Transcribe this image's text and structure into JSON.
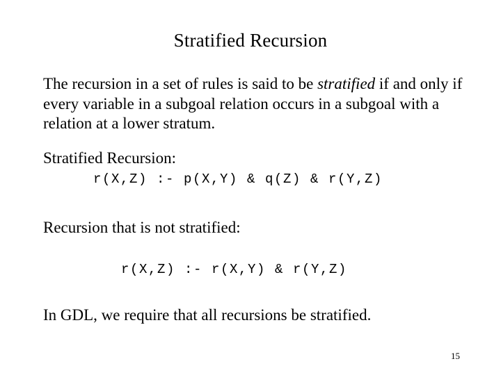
{
  "slide": {
    "title": "Stratified Recursion",
    "background_color": "#ffffff",
    "text_color": "#000000",
    "page_number": "15"
  },
  "definition": {
    "text_before_emphasis": "The recursion in a set of rules is said to be ",
    "emphasized_term": "stratified",
    "text_after_emphasis": " if and only if every variable in a subgoal relation occurs in a subgoal with a relation at a lower stratum."
  },
  "examples": {
    "stratified": {
      "label": "Stratified Recursion:",
      "rule": "r(X,Z) :- p(X,Y) & q(Z) & r(Y,Z)"
    },
    "not_stratified": {
      "label": "Recursion that is not stratified:",
      "rule": "r(X,Z) :- r(X,Y) & r(Y,Z)"
    }
  },
  "closing": {
    "text": "In GDL, we require that all recursions be stratified."
  }
}
